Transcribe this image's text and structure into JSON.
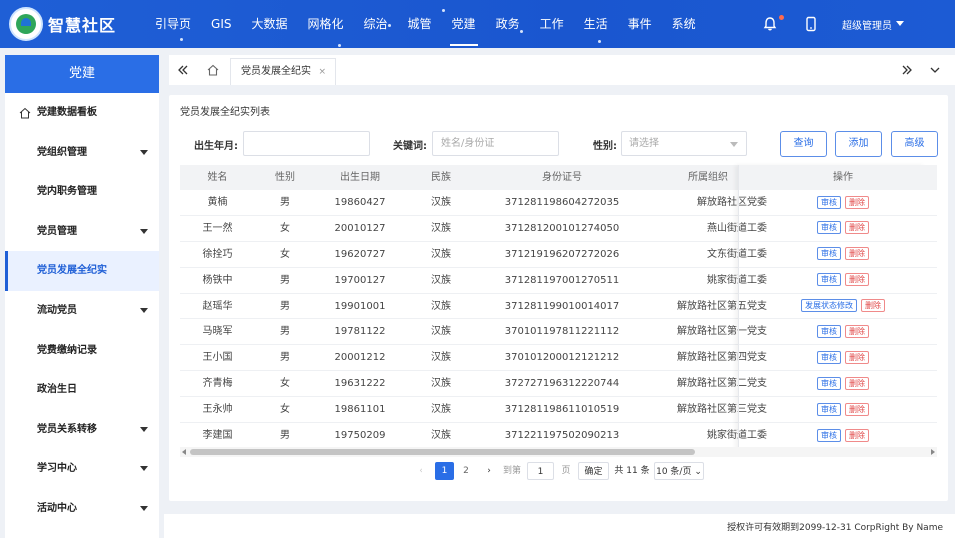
{
  "header": {
    "brand": "智慧社区",
    "nav": [
      "引导页",
      "GIS",
      "大数据",
      "网格化",
      "综治",
      "城管",
      "党建",
      "政务",
      "工作",
      "生活",
      "事件",
      "系统"
    ],
    "active_nav": "党建",
    "user": "超级管理员"
  },
  "sidebar": {
    "title": "党建",
    "items": [
      {
        "label": "党建数据看板",
        "caret": false
      },
      {
        "label": "党组织管理",
        "caret": true
      },
      {
        "label": "党内职务管理",
        "caret": false
      },
      {
        "label": "党员管理",
        "caret": true
      },
      {
        "label": "党员发展全纪实",
        "caret": false,
        "active": true
      },
      {
        "label": "流动党员",
        "caret": true
      },
      {
        "label": "党费缴纳记录",
        "caret": false
      },
      {
        "label": "政治生日",
        "caret": false
      },
      {
        "label": "党员关系转移",
        "caret": true
      },
      {
        "label": "学习中心",
        "caret": true
      },
      {
        "label": "活动中心",
        "caret": true
      }
    ]
  },
  "tabs": {
    "active_tab": "党员发展全纪实",
    "close": "×"
  },
  "main": {
    "title": "党员发展全纪实列表",
    "search": {
      "birth_label": "出生年月:",
      "birth_value": "",
      "keyword_label": "关键词:",
      "keyword_placeholder": "姓名/身份证",
      "gender_label": "性别:",
      "gender_placeholder": "请选择",
      "query": "查询",
      "add": "添加",
      "advanced": "高级"
    },
    "columns": [
      "姓名",
      "性别",
      "出生日期",
      "民族",
      "身份证号",
      "所属组织",
      "操作"
    ],
    "rows": [
      {
        "name": "黄楠",
        "gender": "男",
        "birth": "19860427",
        "ethnic": "汉族",
        "id": "371281198604272035",
        "org": "解放路社区党委",
        "ops": [
          "审核",
          "删除"
        ]
      },
      {
        "name": "王一然",
        "gender": "女",
        "birth": "20010127",
        "ethnic": "汉族",
        "id": "371281200101274050",
        "org": "燕山街道工委",
        "ops": [
          "审核",
          "删除"
        ]
      },
      {
        "name": "徐拴巧",
        "gender": "女",
        "birth": "19620727",
        "ethnic": "汉族",
        "id": "371219196207272026",
        "org": "文东街道工委",
        "ops": [
          "审核",
          "删除"
        ]
      },
      {
        "name": "杨铁中",
        "gender": "男",
        "birth": "19700127",
        "ethnic": "汉族",
        "id": "371281197001270511",
        "org": "姚家街道工委",
        "ops": [
          "审核",
          "删除"
        ]
      },
      {
        "name": "赵瑶华",
        "gender": "男",
        "birth": "19901001",
        "ethnic": "汉族",
        "id": "371281199010014017",
        "org": "解放路社区第五党支",
        "ops": [
          "发展状态修改",
          "删除"
        ]
      },
      {
        "name": "马晓军",
        "gender": "男",
        "birth": "19781122",
        "ethnic": "汉族",
        "id": "370101197811221112",
        "org": "解放路社区第一党支",
        "ops": [
          "审核",
          "删除"
        ]
      },
      {
        "name": "王小国",
        "gender": "男",
        "birth": "20001212",
        "ethnic": "汉族",
        "id": "370101200012121212",
        "org": "解放路社区第四党支",
        "ops": [
          "审核",
          "删除"
        ]
      },
      {
        "name": "齐青梅",
        "gender": "女",
        "birth": "19631222",
        "ethnic": "汉族",
        "id": "372727196312220744",
        "org": "解放路社区第二党支",
        "ops": [
          "审核",
          "删除"
        ]
      },
      {
        "name": "王永帅",
        "gender": "女",
        "birth": "19861101",
        "ethnic": "汉族",
        "id": "371281198611010519",
        "org": "解放路社区第三党支",
        "ops": [
          "审核",
          "删除"
        ]
      },
      {
        "name": "李建国",
        "gender": "男",
        "birth": "19750209",
        "ethnic": "汉族",
        "id": "371221197502090213",
        "org": "姚家街道工委",
        "ops": [
          "审核",
          "删除"
        ]
      }
    ],
    "pagination": {
      "pages": [
        "1",
        "2"
      ],
      "current": "1",
      "goto_prefix": "到第",
      "goto_value": "1",
      "goto_suffix": "页",
      "confirm": "确定",
      "total": "共 11 条",
      "page_size": "10 条/页"
    }
  },
  "footer": {
    "text": "授权许可有效期到2099-12-31 CorpRight By Name"
  },
  "colors": {
    "primary": "#1f5fd6",
    "danger": "#e04646"
  }
}
